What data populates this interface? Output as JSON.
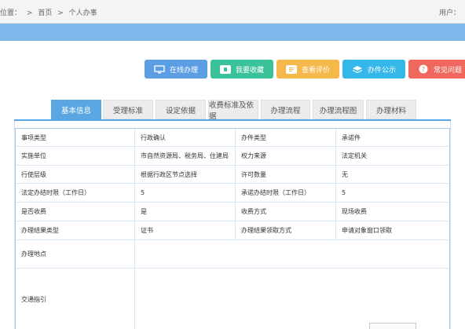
{
  "breadcrumb": {
    "prefix": "位置：",
    "sep1": ">",
    "home": "首页",
    "sep2": ">",
    "current": "个人办事"
  },
  "user_label": "用户：",
  "actions": [
    {
      "label": "在线办理",
      "icon": "monitor-icon",
      "color": "#5b9ee3"
    },
    {
      "label": "我要收藏",
      "icon": "bookmark-icon",
      "color": "#3cc29a"
    },
    {
      "label": "查看评价",
      "icon": "comment-icon",
      "color": "#f7b84b"
    },
    {
      "label": "办件公示",
      "icon": "layers-icon",
      "color": "#35b7ea"
    },
    {
      "label": "常见问题",
      "icon": "question-icon",
      "color": "#f0675e"
    }
  ],
  "tabs": [
    {
      "label": "基本信息",
      "active": true
    },
    {
      "label": "受理标准"
    },
    {
      "label": "设定依据"
    },
    {
      "label": "收费标准及依据"
    },
    {
      "label": "办理流程"
    },
    {
      "label": "办理流程图"
    },
    {
      "label": "办理材料"
    }
  ],
  "table": {
    "rows": [
      [
        "事项类型",
        "行政确认",
        "办件类型",
        "承诺件"
      ],
      [
        "实施单位",
        "市自然资源局、税务局、住建局",
        "权力来源",
        "法定机关"
      ],
      [
        "行使层级",
        "根据行政区节点选择",
        "许可数量",
        "无"
      ],
      [
        "法定办结时限（工作日）",
        "5",
        "承诺办结时限（工作日）",
        "5"
      ],
      [
        "是否收费",
        "是",
        "收费方式",
        "现场收费"
      ],
      [
        "办理结果类型",
        "证书",
        "办理结果领取方式",
        "申请对象窗口领取"
      ]
    ],
    "address_label": "办理地点",
    "address_value": "",
    "traffic_label": "交通指引",
    "traffic_value": ""
  }
}
